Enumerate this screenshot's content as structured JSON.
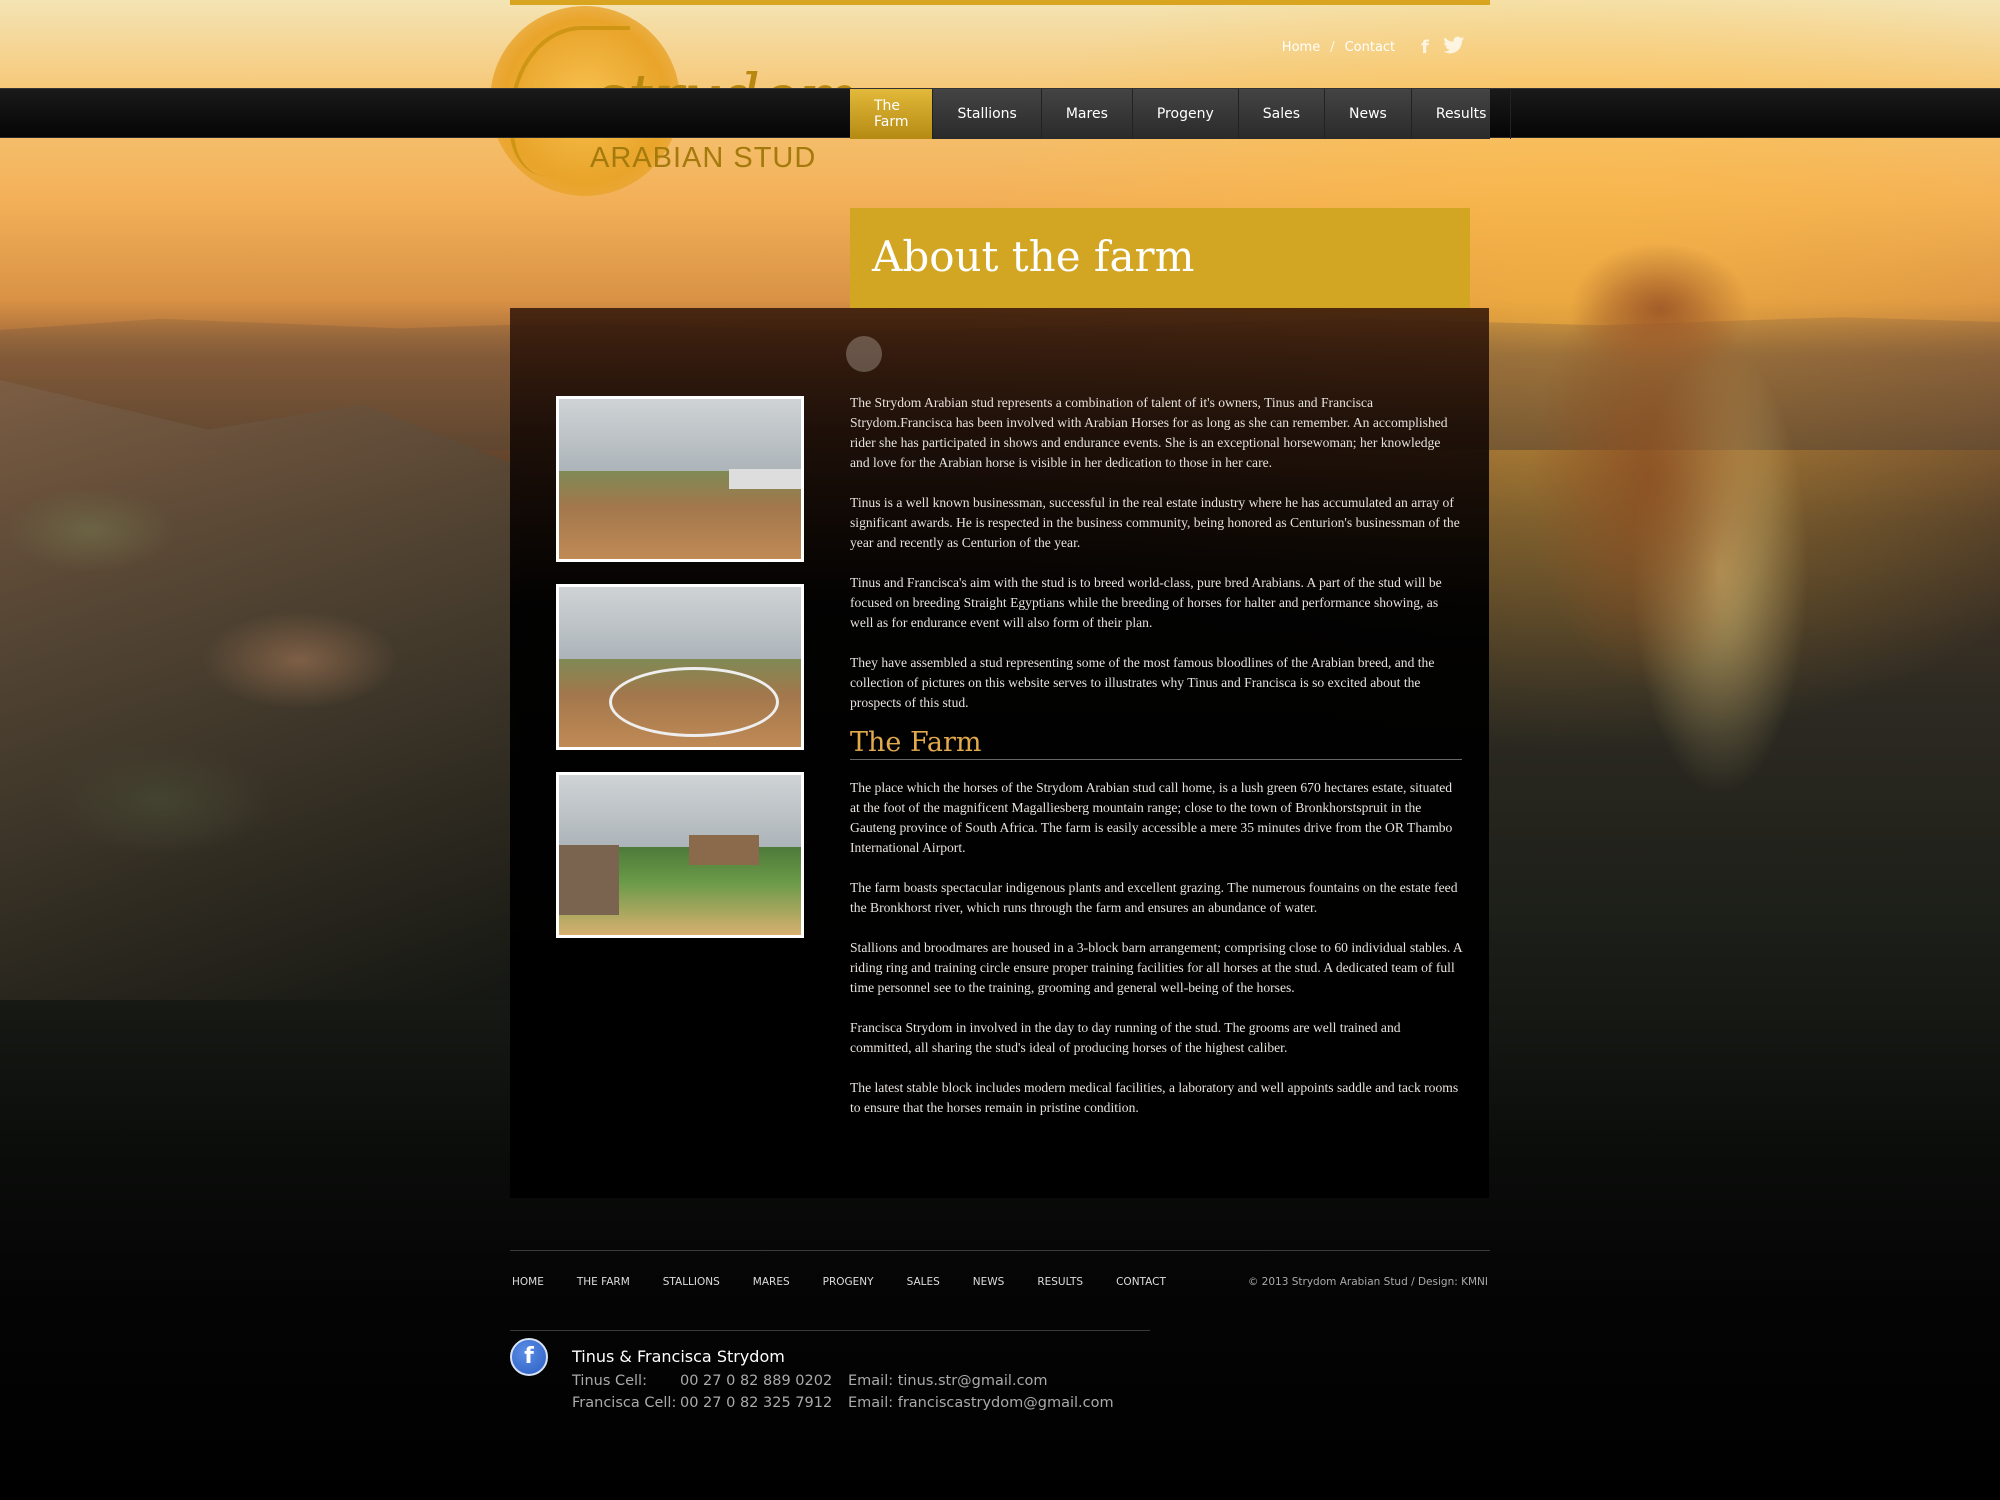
{
  "util_nav": {
    "home": "Home",
    "sep": "/",
    "contact": "Contact",
    "icons": [
      "facebook-icon",
      "twitter-icon"
    ]
  },
  "logo": {
    "script": "strydom",
    "sub": "ARABIAN STUD"
  },
  "nav": {
    "items": [
      "The Farm",
      "Stallions",
      "Mares",
      "Progeny",
      "Sales",
      "News",
      "Results"
    ],
    "active": "The Farm"
  },
  "page": {
    "title": "About the farm"
  },
  "content": {
    "paragraphs": [
      "The Strydom Arabian stud represents a combination of talent of it's owners, Tinus and Francisca Strydom.Francisca has been involved with Arabian Horses for as long as she can remember.  An accomplished rider she has participated in shows and endurance events.  She is an exceptional horsewoman; her knowledge and love for the Arabian horse is visible in her dedication to those in her care.",
      "Tinus is a well known businessman, successful in the real estate industry where he has accumulated an array of significant  awards.  He is respected in the business community, being honored as Centurion's businessman of the year and recently as Centurion of the year.",
      "Tinus and Francisca's aim with the stud is to breed world-class, pure bred Arabians.  A part of the stud will be focused on breeding Straight Egyptians while the breeding of horses for halter and performance showing, as well as for endurance event will also form of their plan.",
      "They have assembled a stud representing some of the most famous bloodlines of the Arabian breed, and the collection of pictures on this website serves to illustrates why Tinus and Francisca is so excited about the prospects of this stud."
    ],
    "farm_heading": "The Farm",
    "farm_paragraphs": [
      "The place which the horses of the Strydom Arabian stud call home, is a lush green 670 hectares estate, situated at the foot of the magnificent Magalliesberg mountain range; close to the town of Bronkhorstspruit in the Gauteng province of South Africa.  The farm is easily accessible a mere 35 minutes drive from the OR Thambo International Airport.",
      "The farm boasts spectacular indigenous plants and excellent grazing.  The numerous fountains on the estate feed the Bronkhorst river, which runs through the farm and ensures an abundance of water.",
      "Stallions and broodmares are housed in a 3-block barn arrangement; comprising close to 60 individual stables.  A riding ring and training circle ensure proper training facilities for all horses at the stud.  A dedicated team of full time personnel see to the training, grooming and general well-being of the horses.",
      "Francisca Strydom in involved in the day to day running of the stud.  The grooms are well trained and committed, all sharing the stud's ideal of producing horses of the highest caliber.",
      "The latest stable block includes modern medical facilities, a laboratory and well appoints saddle and tack rooms to ensure that the horses remain in pristine condition."
    ]
  },
  "footer": {
    "nav": [
      "HOME",
      "THE FARM",
      "STALLIONS",
      "MARES",
      "PROGENY",
      "SALES",
      "NEWS",
      "RESULTS",
      "CONTACT"
    ],
    "copyright": "© 2013 Strydom Arabian Stud   /   Design: KMNI",
    "contact": {
      "name": "Tinus & Francisca Strydom",
      "rows": [
        {
          "label": "Tinus Cell:",
          "phone": "00 27 0 82 889 0202",
          "email": "Email: tinus.str@gmail.com"
        },
        {
          "label": "Francisca Cell:",
          "phone": "00 27 0 82 325 7912",
          "email": "Email: franciscastrydom@gmail.com"
        }
      ]
    }
  }
}
